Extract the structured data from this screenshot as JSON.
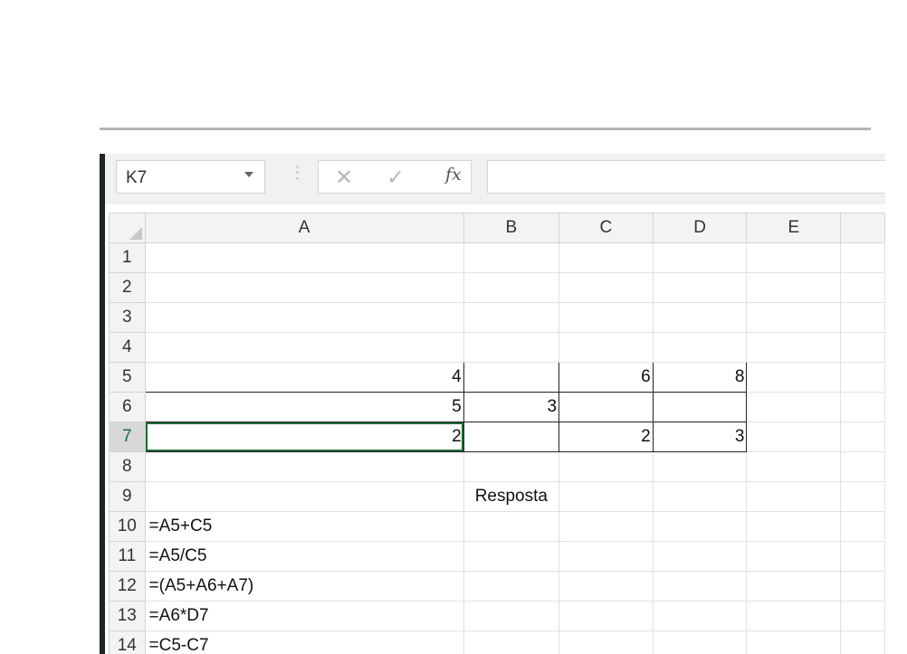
{
  "name_box": {
    "value": "K7"
  },
  "formula_bar": {
    "cancel_icon": "close-icon",
    "enter_icon": "check-icon",
    "fx_label": "fx",
    "value": ""
  },
  "columns": [
    "A",
    "B",
    "C",
    "D",
    "E"
  ],
  "rows": [
    {
      "num": "1",
      "A": "",
      "B": "",
      "C": "",
      "D": ""
    },
    {
      "num": "2",
      "A": "",
      "B": "",
      "C": "",
      "D": ""
    },
    {
      "num": "3",
      "A": "",
      "B": "",
      "C": "",
      "D": ""
    },
    {
      "num": "4",
      "A": "",
      "B": "",
      "C": "",
      "D": ""
    },
    {
      "num": "5",
      "A": "4",
      "B": "",
      "C": "6",
      "D": "8"
    },
    {
      "num": "6",
      "A": "5",
      "B": "3",
      "C": "",
      "D": ""
    },
    {
      "num": "7",
      "A": "2",
      "B": "",
      "C": "2",
      "D": "3"
    },
    {
      "num": "8",
      "A": "",
      "B": "",
      "C": "",
      "D": ""
    },
    {
      "num": "9",
      "A": "",
      "B": "Resposta",
      "C": "",
      "D": ""
    },
    {
      "num": "10",
      "A": "=A5+C5",
      "B": "",
      "C": "",
      "D": ""
    },
    {
      "num": "11",
      "A": "=A5/C5",
      "B": "",
      "C": "",
      "D": ""
    },
    {
      "num": "12",
      "A": "=(A5+A6+A7)",
      "B": "",
      "C": "",
      "D": ""
    },
    {
      "num": "13",
      "A": "=A6*D7",
      "B": "",
      "C": "",
      "D": ""
    },
    {
      "num": "14",
      "A": "=C5-C7",
      "B": "",
      "C": "",
      "D": ""
    }
  ],
  "colors": {
    "accent": "#1e6b38",
    "header_bg": "#f3f3f3"
  }
}
